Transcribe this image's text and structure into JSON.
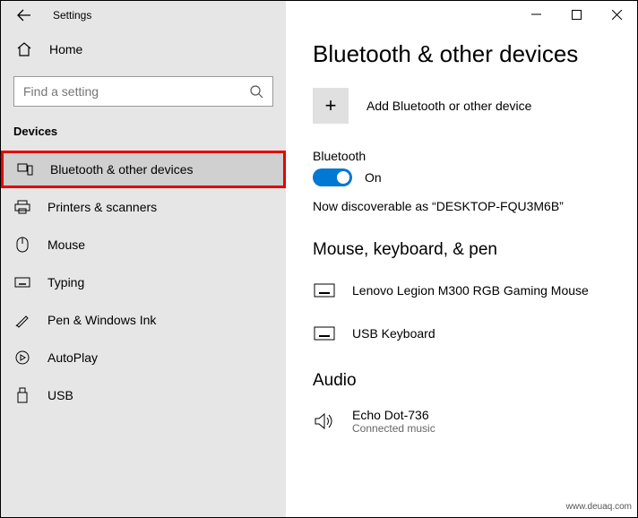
{
  "app_title": "Settings",
  "home_label": "Home",
  "search_placeholder": "Find a setting",
  "category_label": "Devices",
  "nav_items": [
    {
      "label": "Bluetooth & other devices"
    },
    {
      "label": "Printers & scanners"
    },
    {
      "label": "Mouse"
    },
    {
      "label": "Typing"
    },
    {
      "label": "Pen & Windows Ink"
    },
    {
      "label": "AutoPlay"
    },
    {
      "label": "USB"
    }
  ],
  "page_title": "Bluetooth & other devices",
  "add_button_label": "Add Bluetooth or other device",
  "bluetooth": {
    "label": "Bluetooth",
    "state_label": "On",
    "discoverable_text": "Now discoverable as “DESKTOP-FQU3M6B”"
  },
  "groups": {
    "input": {
      "title": "Mouse, keyboard, & pen",
      "devices": [
        {
          "name": "Lenovo Legion M300 RGB Gaming Mouse"
        },
        {
          "name": "USB Keyboard"
        }
      ]
    },
    "audio": {
      "title": "Audio",
      "devices": [
        {
          "name": "Echo Dot-736",
          "sub": "Connected music"
        }
      ]
    }
  },
  "watermark": "www.deuaq.com"
}
